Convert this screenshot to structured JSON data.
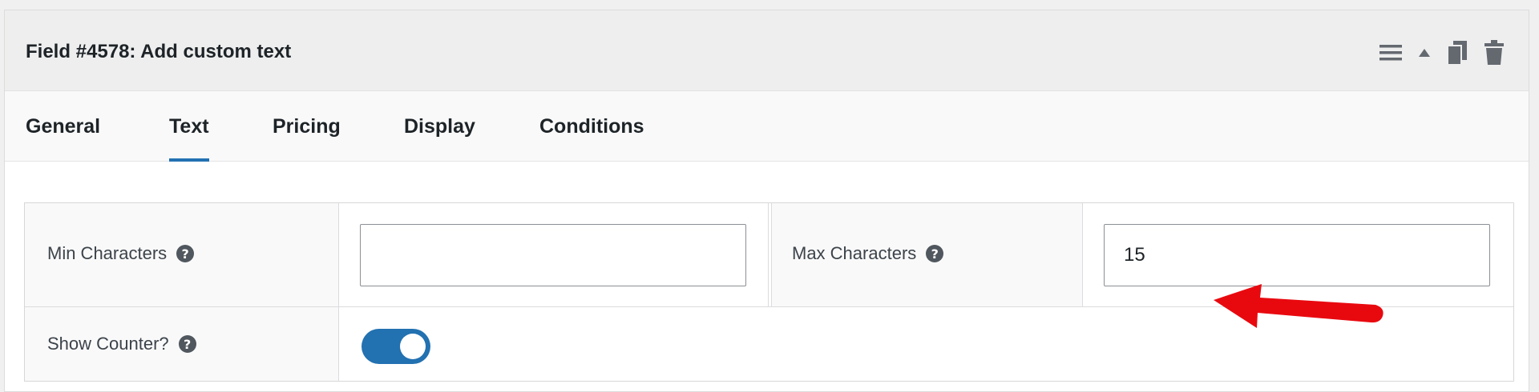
{
  "field": {
    "title": "Field #4578: Add custom text"
  },
  "header_icons": [
    "menu-icon",
    "collapse-arrow-icon",
    "duplicate-icon",
    "trash-icon"
  ],
  "tabs": [
    {
      "label": "General",
      "active": false
    },
    {
      "label": "Text",
      "active": true
    },
    {
      "label": "Pricing",
      "active": false
    },
    {
      "label": "Display",
      "active": false
    },
    {
      "label": "Conditions",
      "active": false
    }
  ],
  "settings": {
    "min_characters": {
      "label": "Min Characters",
      "help": "?",
      "value": ""
    },
    "max_characters": {
      "label": "Max Characters",
      "help": "?",
      "value": "15"
    },
    "show_counter": {
      "label": "Show Counter?",
      "help": "?",
      "enabled": true
    }
  },
  "colors": {
    "accent": "#2271b1",
    "annotation_arrow": "#e8090f"
  }
}
